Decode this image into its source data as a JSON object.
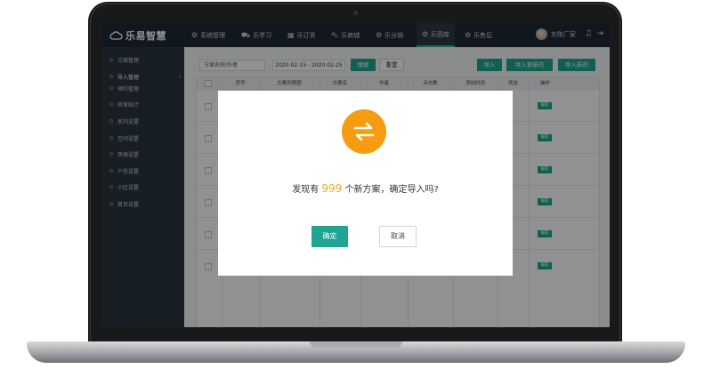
{
  "app": {
    "name": "乐易智慧"
  },
  "topnav": {
    "items": [
      {
        "label": "系统管理",
        "icon": "gear-icon"
      },
      {
        "label": "乐学习",
        "icon": "car-icon"
      },
      {
        "label": "乐订货",
        "icon": "grid-icon"
      },
      {
        "label": "乐商城",
        "icon": "cart-icon"
      },
      {
        "label": "乐分销",
        "icon": "share-icon"
      },
      {
        "label": "乐图库",
        "icon": "gear-icon",
        "active": true
      },
      {
        "label": "乐售后",
        "icon": "gear-icon"
      }
    ],
    "user": "东陈厂家"
  },
  "sidebar": {
    "items": [
      {
        "label": "方案管理"
      },
      {
        "label": "导入管理",
        "active": true
      },
      {
        "label": "预约管理"
      },
      {
        "label": "转发统计"
      },
      {
        "label": "系列设置"
      },
      {
        "label": "空间设置"
      },
      {
        "label": "风格设置"
      },
      {
        "label": "户型设置"
      },
      {
        "label": "小区设置"
      },
      {
        "label": "首页设置"
      }
    ]
  },
  "toolbar": {
    "search_placeholder": "方案名称/作者",
    "date_range": "2020-02-15 - 2020-02-25",
    "search_label": "搜索",
    "reset_label": "重置",
    "import_label": "导入",
    "import_updated_label": "导入更新的",
    "import_new_label": "导入新的"
  },
  "table": {
    "headers": [
      "序号",
      "方案列表图",
      "方案名",
      "作者",
      "点击数",
      "添加时间",
      "状态",
      "操作"
    ],
    "row_action": "编辑",
    "row_count": 6
  },
  "modal": {
    "message_prefix": "发现有",
    "count": "999",
    "message_suffix": "个新方案，确定导入吗?",
    "confirm_label": "确定",
    "cancel_label": "取消",
    "icon": "swap-arrows-icon",
    "icon_color": "#f59c10",
    "accent_color": "#1fa592"
  }
}
